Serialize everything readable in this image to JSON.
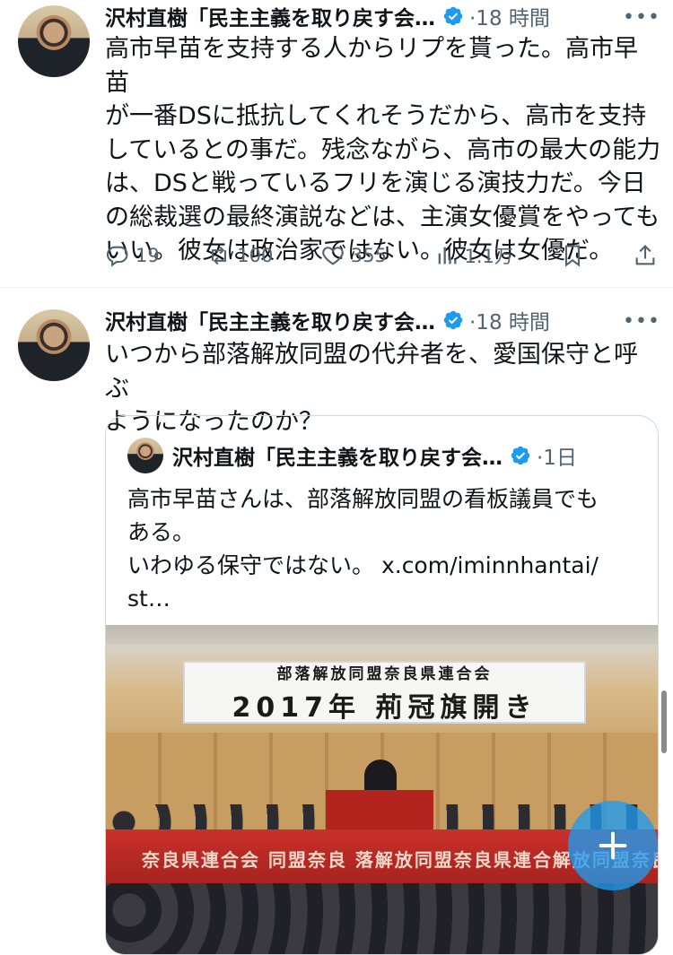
{
  "tweets": [
    {
      "author": "沢村直樹「民主主義を取り戻す会…",
      "time": "·18 時間",
      "text": "高市早苗を支持する人からリプを貰った。高市早苗\nが一番DSに抵抗してくれそうだから、高市を支持\nしているとの事だ。残念ながら、高市の最大の能力\nは、DSと戦っているフリを演じる演技力だ。今日\nの総裁選の最終演説などは、主演女優賞をやっても\nいい。彼女は政治家ではない。彼女は女優だ。",
      "replies": "19",
      "retweets": "100",
      "likes": "355",
      "views": "1.1万"
    },
    {
      "author": "沢村直樹「民主主義を取り戻す会…",
      "time": "·18 時間",
      "text": "いつから部落解放同盟の代弁者を、愛国保守と呼ぶ\nようになったのか？",
      "quote": {
        "author": "沢村直樹「民主主義を取り戻す会…",
        "time": "·1日",
        "text": "高市早苗さんは、部落解放同盟の看板議員でも\nある。\nいわゆる保守ではない。 x.com/iminnhantai/\nst…",
        "banner_line1": "部落解放同盟奈良県連合会",
        "banner_line2": "2017年 荊冠旗開き",
        "stage_text": "奈良県連合会   同盟奈良  落解放同盟奈良県連合解放同盟奈良県連合会"
      }
    }
  ],
  "icons": {
    "verified": "verified-badge-icon",
    "more": "more-icon",
    "reply": "reply-icon",
    "retweet": "retweet-icon",
    "like": "heart-icon",
    "views": "views-icon",
    "bookmark": "bookmark-icon",
    "share": "share-icon",
    "compose": "compose-plus-icon"
  },
  "colors": {
    "verified": "#1d9bf0",
    "text_secondary": "#536471",
    "fab": "#1d9bf0"
  }
}
